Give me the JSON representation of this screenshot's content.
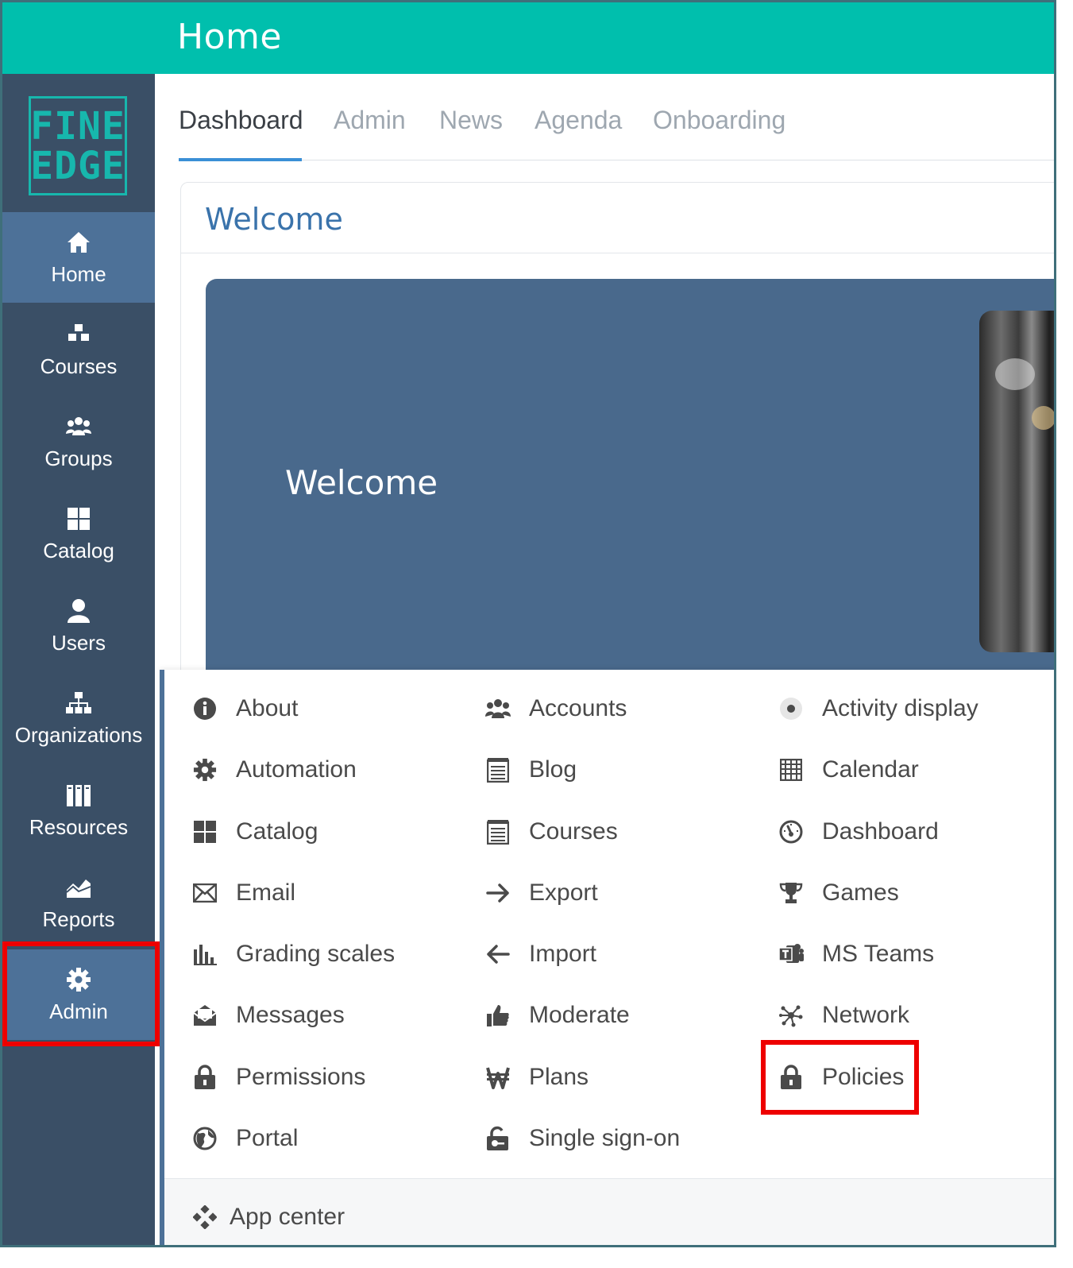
{
  "header": {
    "title": "Home"
  },
  "logo": {
    "line1": "FINE",
    "line2": "EDGE"
  },
  "sidebar": {
    "items": [
      {
        "label": "Home",
        "icon": "home-icon"
      },
      {
        "label": "Courses",
        "icon": "boxes-icon"
      },
      {
        "label": "Groups",
        "icon": "group-icon"
      },
      {
        "label": "Catalog",
        "icon": "grid-icon"
      },
      {
        "label": "Users",
        "icon": "user-icon"
      },
      {
        "label": "Organizations",
        "icon": "org-chart-icon"
      },
      {
        "label": "Resources",
        "icon": "books-icon"
      },
      {
        "label": "Reports",
        "icon": "chart-icon"
      },
      {
        "label": "Admin",
        "icon": "gear-icon"
      }
    ]
  },
  "tabs": [
    "Dashboard",
    "Admin",
    "News",
    "Agenda",
    "Onboarding"
  ],
  "card": {
    "title": "Welcome",
    "banner_text": "Welcome"
  },
  "admin_menu": {
    "col1": [
      {
        "label": "About",
        "icon": "info-icon"
      },
      {
        "label": "Automation",
        "icon": "gear-icon"
      },
      {
        "label": "Catalog",
        "icon": "grid-icon"
      },
      {
        "label": "Email",
        "icon": "envelope-icon"
      },
      {
        "label": "Grading scales",
        "icon": "bar-chart-icon"
      },
      {
        "label": "Messages",
        "icon": "open-envelope-icon"
      },
      {
        "label": "Permissions",
        "icon": "lock-icon"
      },
      {
        "label": "Portal",
        "icon": "globe-icon"
      }
    ],
    "col2": [
      {
        "label": "Accounts",
        "icon": "group-icon"
      },
      {
        "label": "Blog",
        "icon": "notepad-icon"
      },
      {
        "label": "Courses",
        "icon": "notepad-icon"
      },
      {
        "label": "Export",
        "icon": "arrow-right-icon"
      },
      {
        "label": "Import",
        "icon": "arrow-left-icon"
      },
      {
        "label": "Moderate",
        "icon": "thumbs-up-icon"
      },
      {
        "label": "Plans",
        "icon": "won-icon"
      },
      {
        "label": "Single sign-on",
        "icon": "unlock-icon"
      }
    ],
    "col3": [
      {
        "label": "Activity display",
        "icon": "radio-dot-icon"
      },
      {
        "label": "Calendar",
        "icon": "calendar-grid-icon"
      },
      {
        "label": "Dashboard",
        "icon": "gauge-icon"
      },
      {
        "label": "Games",
        "icon": "trophy-icon"
      },
      {
        "label": "MS Teams",
        "icon": "teams-icon"
      },
      {
        "label": "Network",
        "icon": "network-icon"
      },
      {
        "label": "Policies",
        "icon": "lock-icon"
      }
    ],
    "app_center": {
      "label": "App center",
      "icon": "apps-diamond-icon"
    }
  },
  "colors": {
    "topbar": "#00bfad",
    "sidebar": "#3a4f66",
    "sidebar_active": "#4d7198",
    "banner": "#49698c",
    "accent_blue": "#3a8fd6",
    "highlight": "#ee0000"
  }
}
